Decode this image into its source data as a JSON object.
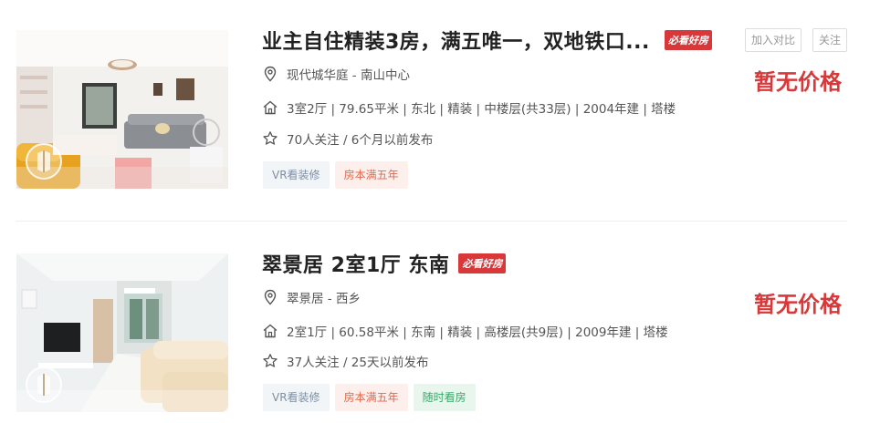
{
  "listings": [
    {
      "title": "业主自住精装3房，满五唯一，双地铁口...",
      "badge": "必看好房",
      "actions": {
        "compare": "加入对比",
        "follow": "关注"
      },
      "price": "暂无价格",
      "location": "现代城华庭 - 南山中心",
      "house_info": "3室2厅 | 79.65平米 | 东北 | 精装 | 中楼层(共33层) | 2004年建 | 塔楼",
      "follow_info": "70人关注 / 6个月以前发布",
      "tags": [
        "VR看装修",
        "房本满五年"
      ],
      "icons": {
        "location": "location-pin-icon",
        "house": "house-icon",
        "follow": "star-icon",
        "vr": "vr-badge-icon"
      }
    },
    {
      "title": "翠景居 2室1厅 东南",
      "badge": "必看好房",
      "price": "暂无价格",
      "location": "翠景居 - 西乡",
      "house_info": "2室1厅 | 60.58平米 | 东南 | 精装 | 高楼层(共9层) | 2009年建 | 塔楼",
      "follow_info": "37人关注 / 25天以前发布",
      "tags": [
        "VR看装修",
        "房本满五年",
        "随时看房"
      ],
      "icons": {
        "location": "location-pin-icon",
        "house": "house-icon",
        "follow": "star-icon",
        "vr": "vr-badge-icon"
      }
    }
  ],
  "colors": {
    "accent_red": "#d9383a",
    "tag_vr_text": "#7e8ea1",
    "tag_years_text": "#e5674b",
    "tag_anytime_text": "#39a86a"
  }
}
